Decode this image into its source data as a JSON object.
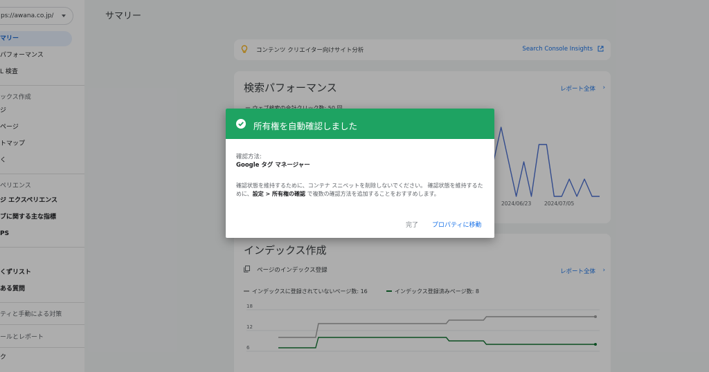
{
  "sidebar": {
    "property": "ps://awana.co.jp/",
    "items": [
      {
        "label": "マリー",
        "active": true
      },
      {
        "label": "パフォーマンス"
      },
      {
        "label": "L 検査"
      },
      {
        "section": "ックス作成"
      },
      {
        "label": "ジ"
      },
      {
        "label": "ページ"
      },
      {
        "label": "トマップ"
      },
      {
        "label": "く"
      },
      {
        "section": "ペリエンス"
      },
      {
        "label": "ジ エクスペリエンス",
        "bold": true
      },
      {
        "label": "ブに関する主な指標",
        "bold": true
      },
      {
        "label": "PS",
        "bold": true
      },
      {
        "label": "くずリスト",
        "bold": true
      },
      {
        "label": "ある質問",
        "bold": true
      },
      {
        "section": "ティと手動による対策"
      },
      {
        "section": "ールとレポート"
      },
      {
        "label": "ク"
      }
    ]
  },
  "header": {
    "title": "サマリー"
  },
  "insights": {
    "label": "コンテンツ クリエイター向けサイト分析",
    "link": "Search Console Insights"
  },
  "performance": {
    "title": "検索パフォーマンス",
    "report_link": "レポート全体",
    "legend": "ー ウェブ検索の合計クリック数: 50 回",
    "chart_data": {
      "type": "line",
      "x": [
        "2024/06/23",
        "2024/07/05"
      ],
      "series": [
        {
          "values": [
            0,
            2,
            0,
            2,
            2,
            2,
            4,
            2,
            0,
            2,
            0,
            3,
            3,
            0,
            0,
            1,
            0,
            1,
            0,
            0
          ]
        }
      ],
      "color": "#4a6fd0"
    }
  },
  "index": {
    "title": "インデックス作成",
    "sub": "ページのインデックス登録",
    "report_link": "レポート全体",
    "legend_not": "インデックスに登録されていないページ数: 16",
    "legend_yes": "インデックス登録済みページ数: 8",
    "chart_data": {
      "type": "line",
      "yticks": [
        "18",
        "12",
        "6"
      ],
      "ylim": [
        0,
        18
      ],
      "series": [
        {
          "name": "インデックスに登録されていないページ数: 16",
          "color": "#9e9e9e",
          "values": [
            10,
            10,
            10,
            14,
            14,
            14,
            14,
            14,
            14,
            14,
            15,
            15,
            16,
            16,
            16,
            16,
            16,
            16
          ]
        },
        {
          "name": "インデックス登録済みページ数: 8",
          "color": "#137333",
          "values": [
            7,
            7,
            7,
            10,
            10,
            10,
            10,
            10,
            10,
            10,
            9,
            9,
            8,
            8,
            8,
            8,
            8,
            8
          ]
        }
      ]
    }
  },
  "dialog": {
    "title": "所有権を自動確認しました",
    "method_label": "確認方法:",
    "method_value": "Google タグ マネージャー",
    "desc_1": "確認状態を維持するために、コンテナ スニペットを削除しないでください。 確認状態を維持するために、",
    "desc_bold": "設定 > 所有権の確認",
    "desc_2": " で複数の確認方法を追加することをおすすめします。",
    "done": "完了",
    "go": "プロパティに移動",
    "header_color": "#1ea362"
  }
}
